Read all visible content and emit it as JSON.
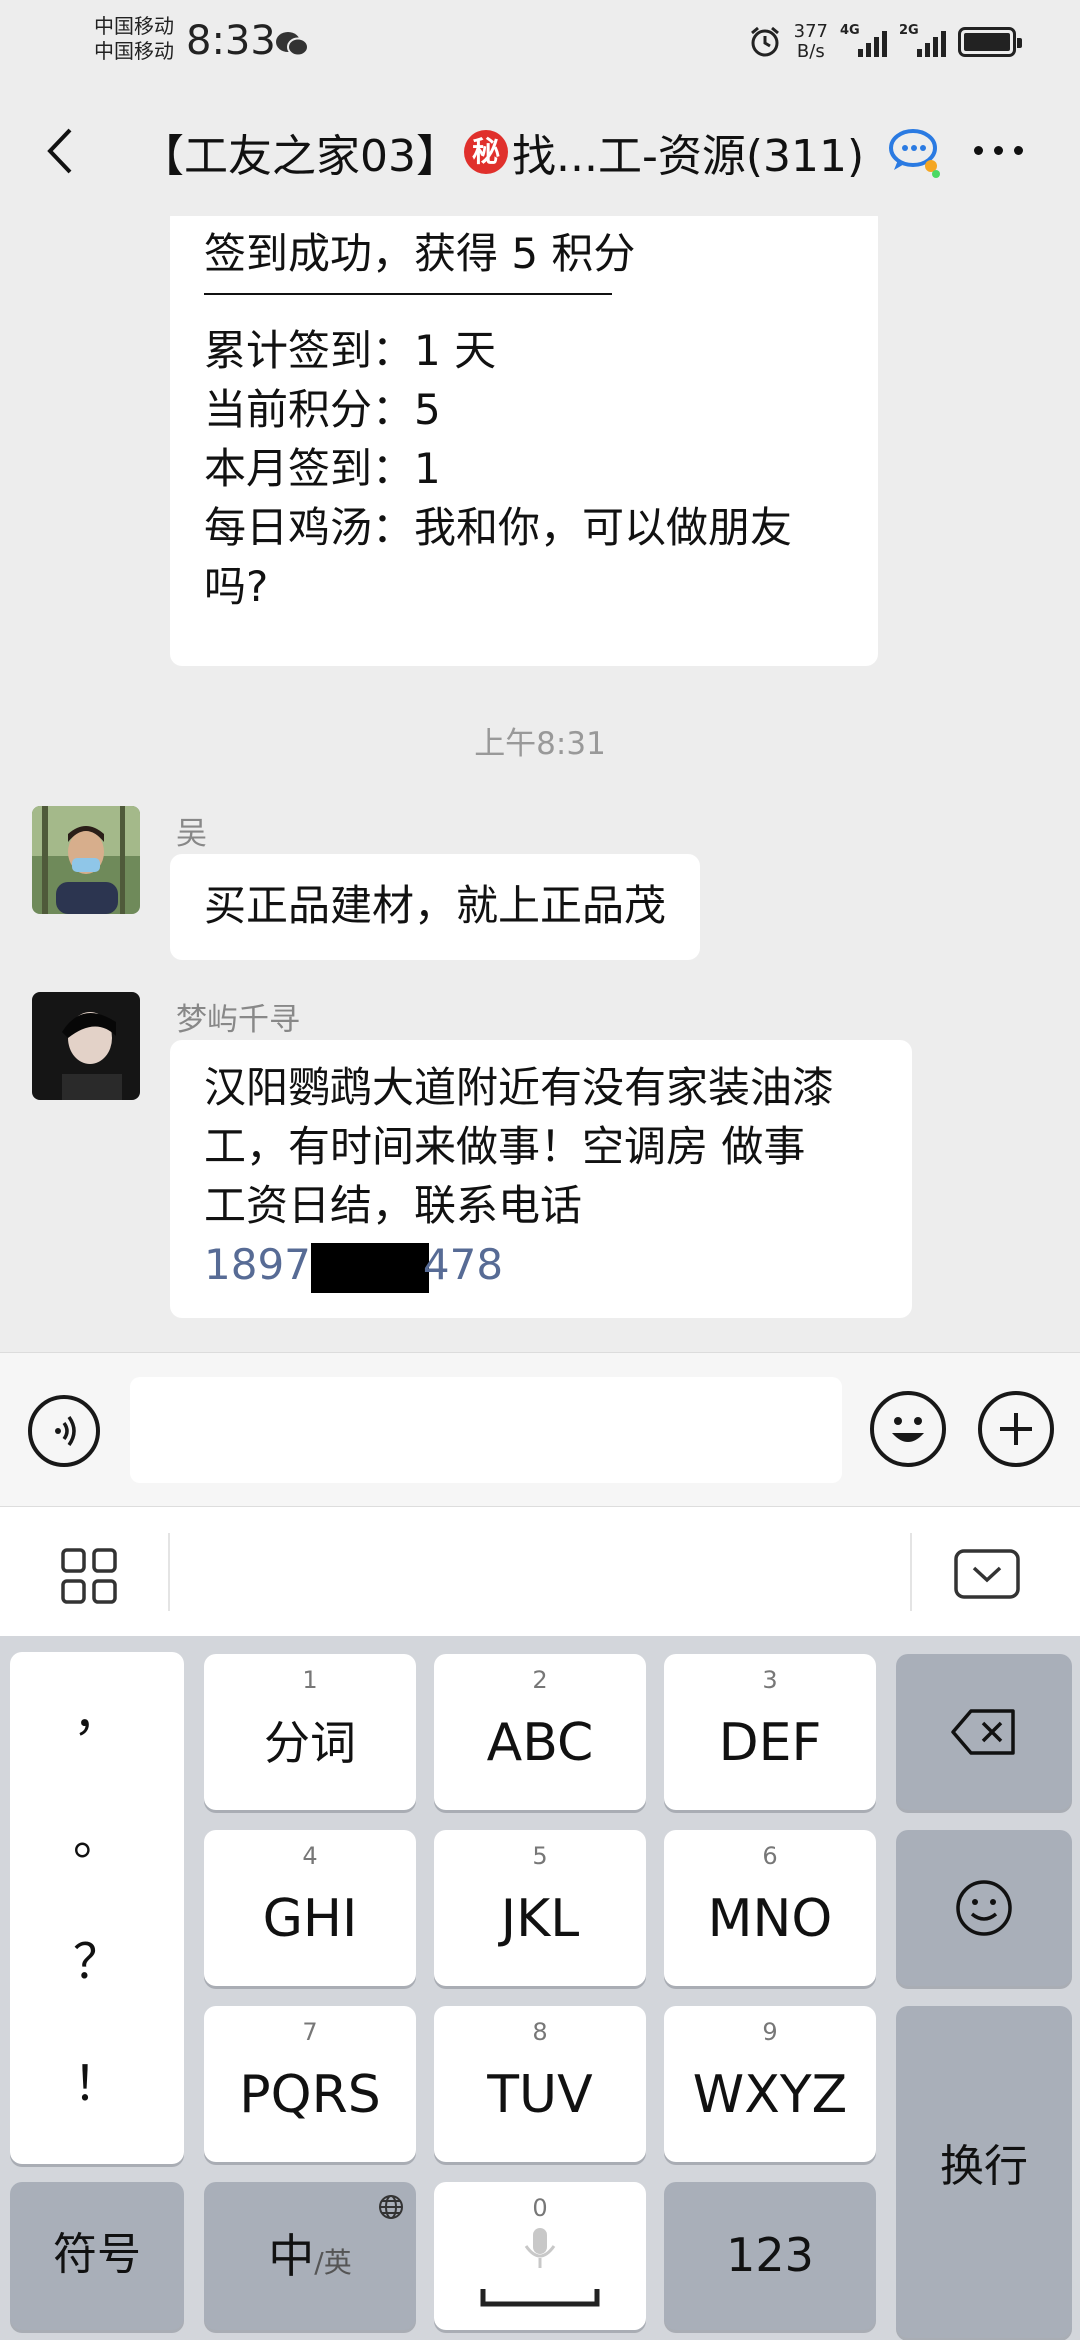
{
  "status_bar": {
    "carrier_1": "中国移动",
    "carrier_2": "中国移动",
    "time": "8:33",
    "net_speed_value": "377",
    "net_speed_unit": "B/s",
    "sim1_label": "4G",
    "sim2_label": "2G"
  },
  "header": {
    "title_prefix": "【工友之家03】",
    "secret_badge": "秘",
    "title_suffix": "找...工-资源(311)"
  },
  "messages": {
    "checkin": {
      "line1": "签到成功，获得 5 积分",
      "line2": "累计签到：1 天",
      "line3": "当前积分：5",
      "line4": "本月签到：1",
      "line5": "每日鸡汤：我和你，可以做朋友",
      "line6": "吗?"
    },
    "timestamp": "上午8:31",
    "wu": {
      "sender": "吴",
      "text": "买正品建材，就上正品茂"
    },
    "mengyu": {
      "sender": "梦屿千寻",
      "line1": "汉阳鹦鹉大道附近有没有家装油漆",
      "line2": "工，有时间来做事！空调房 做事",
      "line3": "工资日结，联系电话",
      "phone_start": "1897",
      "phone_end": "478"
    }
  },
  "input": {
    "placeholder": ""
  },
  "keyboard": {
    "punctuation": [
      "，",
      "。",
      "？",
      "！"
    ],
    "keys": [
      {
        "num": "1",
        "label": "分词"
      },
      {
        "num": "2",
        "label": "ABC"
      },
      {
        "num": "3",
        "label": "DEF"
      },
      {
        "num": "4",
        "label": "GHI"
      },
      {
        "num": "5",
        "label": "JKL"
      },
      {
        "num": "6",
        "label": "MNO"
      },
      {
        "num": "7",
        "label": "PQRS"
      },
      {
        "num": "8",
        "label": "TUV"
      },
      {
        "num": "9",
        "label": "WXYZ"
      }
    ],
    "symbols": "符号",
    "lang_main": "中",
    "lang_alt": "/英",
    "space_num": "0",
    "num_mode": "123",
    "enter": "换行"
  },
  "colors": {
    "background": "#ededed",
    "link": "#576b95",
    "secret_badge": "#e0302c"
  }
}
